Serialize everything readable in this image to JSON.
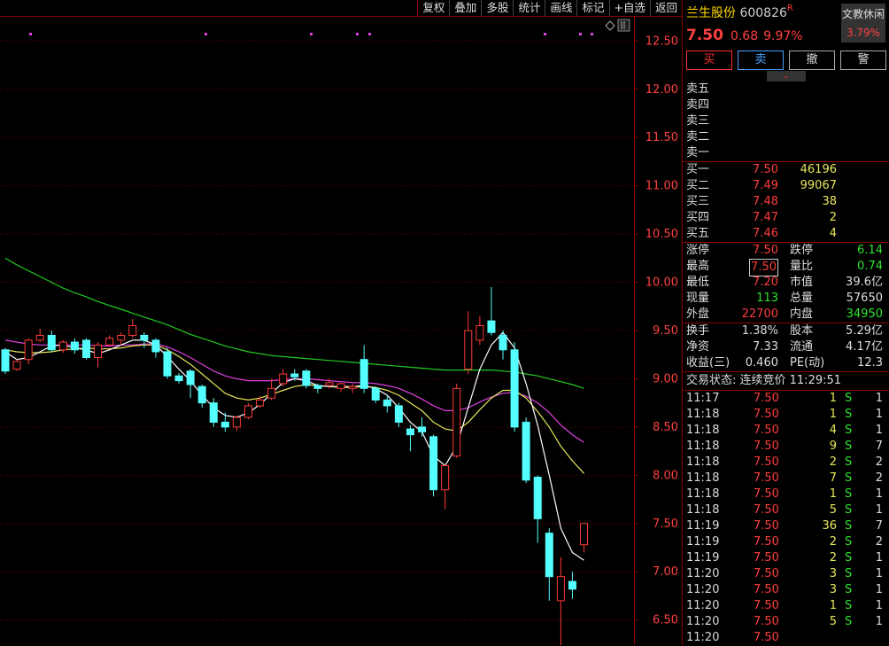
{
  "toolbar": [
    "复权",
    "叠加",
    "多股",
    "统计",
    "画线",
    "标记",
    "+自选",
    "返回"
  ],
  "stock": {
    "name": "兰生股份",
    "code": "600826",
    "mark": "R",
    "price": "7.50",
    "change": "0.68",
    "pct": "9.97%"
  },
  "status_box": {
    "label": "文教休闲",
    "value": "3.79%"
  },
  "actions": {
    "buy": "买",
    "sell": "卖",
    "cancel": "撤",
    "alert": "警"
  },
  "collapse_icon": "chevron-down",
  "ask": [
    {
      "label": "卖五"
    },
    {
      "label": "卖四"
    },
    {
      "label": "卖三"
    },
    {
      "label": "卖二"
    },
    {
      "label": "卖一"
    }
  ],
  "bid": [
    {
      "label": "买一",
      "price": "7.50",
      "vol": "46196"
    },
    {
      "label": "买二",
      "price": "7.49",
      "vol": "99067"
    },
    {
      "label": "买三",
      "price": "7.48",
      "vol": "38"
    },
    {
      "label": "买四",
      "price": "7.47",
      "vol": "2"
    },
    {
      "label": "买五",
      "price": "7.46",
      "vol": "4"
    }
  ],
  "stats": [
    {
      "l1": "涨停",
      "v1": "7.50",
      "c1": "red",
      "l2": "跌停",
      "v2": "6.14",
      "c2": "green"
    },
    {
      "l1": "最高",
      "v1": "7.50",
      "c1": "red boxed",
      "l2": "量比",
      "v2": "0.74",
      "c2": "green"
    },
    {
      "l1": "最低",
      "v1": "7.20",
      "c1": "red",
      "l2": "市值",
      "v2": "39.6亿",
      "c2": "white"
    },
    {
      "l1": "现量",
      "v1": "113",
      "c1": "green",
      "l2": "总量",
      "v2": "57650",
      "c2": "white"
    },
    {
      "l1": "外盘",
      "v1": "22700",
      "c1": "red",
      "l2": "内盘",
      "v2": "34950",
      "c2": "green"
    }
  ],
  "fund": [
    {
      "l1": "换手",
      "v1": "1.38%",
      "l2": "股本",
      "v2": "5.29亿"
    },
    {
      "l1": "净资",
      "v1": "7.33",
      "l2": "流通",
      "v2": "4.17亿"
    },
    {
      "l1": "收益(三)",
      "v1": "0.460",
      "l2": "PE(动)",
      "v2": "12.3"
    }
  ],
  "trade_status": "交易状态: 连续竞价 11:29:51",
  "ticks": [
    {
      "t": "11:17",
      "p": "7.50",
      "v": "1",
      "bs": "S",
      "n": "1"
    },
    {
      "t": "11:18",
      "p": "7.50",
      "v": "1",
      "bs": "S",
      "n": "1"
    },
    {
      "t": "11:18",
      "p": "7.50",
      "v": "4",
      "bs": "S",
      "n": "1"
    },
    {
      "t": "11:18",
      "p": "7.50",
      "v": "9",
      "bs": "S",
      "n": "7"
    },
    {
      "t": "11:18",
      "p": "7.50",
      "v": "2",
      "bs": "S",
      "n": "2"
    },
    {
      "t": "11:18",
      "p": "7.50",
      "v": "7",
      "bs": "S",
      "n": "2"
    },
    {
      "t": "11:18",
      "p": "7.50",
      "v": "1",
      "bs": "S",
      "n": "1"
    },
    {
      "t": "11:18",
      "p": "7.50",
      "v": "5",
      "bs": "S",
      "n": "1"
    },
    {
      "t": "11:19",
      "p": "7.50",
      "v": "36",
      "bs": "S",
      "n": "7"
    },
    {
      "t": "11:19",
      "p": "7.50",
      "v": "2",
      "bs": "S",
      "n": "2"
    },
    {
      "t": "11:19",
      "p": "7.50",
      "v": "2",
      "bs": "S",
      "n": "1"
    },
    {
      "t": "11:20",
      "p": "7.50",
      "v": "3",
      "bs": "S",
      "n": "1"
    },
    {
      "t": "11:20",
      "p": "7.50",
      "v": "3",
      "bs": "S",
      "n": "1"
    },
    {
      "t": "11:20",
      "p": "7.50",
      "v": "1",
      "bs": "S",
      "n": "1"
    },
    {
      "t": "11:20",
      "p": "7.50",
      "v": "5",
      "bs": "S",
      "n": "1"
    },
    {
      "t": "11:20",
      "p": "7.50",
      "v": "",
      "bs": "",
      "n": ""
    }
  ],
  "chart_data": {
    "type": "candlestick",
    "y_ticks": [
      "12.50",
      "12.00",
      "11.50",
      "11.00",
      "10.50",
      "10.00",
      "9.50",
      "9.00",
      "8.50",
      "8.00",
      "7.50",
      "7.00",
      "6.50"
    ],
    "ylim": [
      6.24,
      12.76
    ],
    "low_label": "6.18",
    "candles": [
      [
        9.3,
        9.08,
        9.32,
        9.05
      ],
      [
        9.1,
        9.18,
        9.2,
        9.08
      ],
      [
        9.2,
        9.4,
        9.42,
        9.15
      ],
      [
        9.4,
        9.45,
        9.52,
        9.38
      ],
      [
        9.45,
        9.3,
        9.5,
        9.28
      ],
      [
        9.3,
        9.38,
        9.4,
        9.27
      ],
      [
        9.38,
        9.3,
        9.42,
        9.26
      ],
      [
        9.4,
        9.22,
        9.42,
        9.2
      ],
      [
        9.22,
        9.35,
        9.38,
        9.12
      ],
      [
        9.35,
        9.42,
        9.45,
        9.33
      ],
      [
        9.4,
        9.45,
        9.48,
        9.35
      ],
      [
        9.45,
        9.55,
        9.62,
        9.42
      ],
      [
        9.45,
        9.4,
        9.48,
        9.32
      ],
      [
        9.4,
        9.28,
        9.42,
        9.22
      ],
      [
        9.28,
        9.03,
        9.32,
        9.0
      ],
      [
        9.03,
        8.98,
        9.06,
        8.95
      ],
      [
        9.08,
        8.94,
        9.1,
        8.8
      ],
      [
        8.92,
        8.75,
        8.94,
        8.7
      ],
      [
        8.75,
        8.55,
        8.8,
        8.5
      ],
      [
        8.55,
        8.5,
        8.65,
        8.45
      ],
      [
        8.5,
        8.6,
        8.62,
        8.46
      ],
      [
        8.6,
        8.72,
        8.75,
        8.58
      ],
      [
        8.72,
        8.78,
        8.82,
        8.7
      ],
      [
        8.8,
        8.9,
        9.0,
        8.78
      ],
      [
        8.95,
        9.05,
        9.1,
        8.92
      ],
      [
        9.05,
        9.02,
        9.1,
        8.98
      ],
      [
        9.08,
        8.93,
        9.1,
        8.9
      ],
      [
        8.93,
        8.9,
        8.95,
        8.85
      ],
      [
        8.93,
        8.96,
        9.0,
        8.9
      ],
      [
        8.9,
        8.95,
        8.96,
        8.86
      ],
      [
        8.9,
        8.92,
        8.95,
        8.85
      ],
      [
        9.2,
        8.9,
        9.35,
        8.85
      ],
      [
        8.9,
        8.78,
        8.92,
        8.75
      ],
      [
        8.78,
        8.72,
        8.82,
        8.65
      ],
      [
        8.72,
        8.55,
        8.75,
        8.5
      ],
      [
        8.48,
        8.42,
        8.52,
        8.25
      ],
      [
        8.5,
        8.45,
        8.6,
        8.4
      ],
      [
        8.4,
        7.85,
        8.42,
        7.78
      ],
      [
        7.85,
        8.1,
        8.12,
        7.65
      ],
      [
        8.2,
        8.9,
        8.95,
        8.18
      ],
      [
        9.1,
        9.5,
        9.7,
        9.05
      ],
      [
        9.4,
        9.55,
        9.65,
        9.35
      ],
      [
        9.6,
        9.48,
        9.95,
        9.45
      ],
      [
        9.45,
        9.3,
        9.5,
        9.2
      ],
      [
        9.3,
        8.5,
        9.38,
        8.45
      ],
      [
        8.55,
        7.95,
        8.6,
        7.92
      ],
      [
        7.98,
        7.55,
        8.0,
        7.3
      ],
      [
        7.4,
        6.95,
        7.45,
        6.7
      ],
      [
        6.7,
        6.95,
        7.15,
        6.18
      ],
      [
        6.9,
        6.82,
        7.0,
        6.72
      ],
      [
        7.28,
        7.5,
        7.5,
        7.2
      ]
    ],
    "ma_white": [
      9.28,
      9.2,
      9.22,
      9.28,
      9.34,
      9.35,
      9.32,
      9.3,
      9.26,
      9.3,
      9.35,
      9.4,
      9.4,
      9.35,
      9.23,
      9.1,
      8.98,
      8.83,
      8.7,
      8.62,
      8.6,
      8.65,
      8.73,
      8.85,
      8.96,
      9.0,
      8.98,
      8.93,
      8.92,
      8.92,
      8.92,
      8.93,
      8.9,
      8.83,
      8.7,
      8.55,
      8.45,
      8.2,
      8.1,
      8.3,
      8.7,
      9.1,
      9.35,
      9.48,
      9.32,
      8.95,
      8.52,
      8.0,
      7.45,
      7.2,
      7.12
    ],
    "ma_yellow": [
      9.3,
      9.28,
      9.27,
      9.27,
      9.28,
      9.3,
      9.31,
      9.32,
      9.31,
      9.31,
      9.32,
      9.34,
      9.35,
      9.35,
      9.3,
      9.23,
      9.15,
      9.05,
      8.95,
      8.85,
      8.8,
      8.78,
      8.8,
      8.84,
      8.88,
      8.92,
      8.94,
      8.93,
      8.92,
      8.91,
      8.91,
      8.92,
      8.91,
      8.88,
      8.83,
      8.75,
      8.67,
      8.55,
      8.48,
      8.46,
      8.55,
      8.68,
      8.8,
      8.88,
      8.88,
      8.8,
      8.66,
      8.5,
      8.3,
      8.15,
      8.02
    ],
    "ma_pink": [
      9.4,
      9.38,
      9.36,
      9.35,
      9.35,
      9.35,
      9.35,
      9.35,
      9.34,
      9.34,
      9.35,
      9.35,
      9.36,
      9.36,
      9.33,
      9.28,
      9.22,
      9.15,
      9.08,
      9.03,
      9.0,
      8.98,
      8.98,
      8.98,
      8.99,
      9.0,
      9.0,
      8.99,
      8.98,
      8.97,
      8.96,
      8.96,
      8.95,
      8.93,
      8.9,
      8.85,
      8.79,
      8.72,
      8.67,
      8.67,
      8.7,
      8.76,
      8.81,
      8.85,
      8.86,
      8.82,
      8.75,
      8.65,
      8.52,
      8.42,
      8.34
    ],
    "ma_green": [
      10.25,
      10.18,
      10.12,
      10.06,
      10.0,
      9.94,
      9.89,
      9.85,
      9.8,
      9.76,
      9.72,
      9.68,
      9.64,
      9.6,
      9.56,
      9.51,
      9.46,
      9.42,
      9.38,
      9.34,
      9.31,
      9.28,
      9.26,
      9.24,
      9.23,
      9.22,
      9.21,
      9.2,
      9.19,
      9.18,
      9.17,
      9.16,
      9.15,
      9.14,
      9.13,
      9.12,
      9.11,
      9.1,
      9.09,
      9.09,
      9.09,
      9.09,
      9.09,
      9.08,
      9.07,
      9.05,
      9.03,
      9.0,
      8.97,
      8.94,
      8.9
    ],
    "pink_dots": [
      33,
      231,
      350,
      402,
      416,
      614,
      654,
      667
    ]
  }
}
